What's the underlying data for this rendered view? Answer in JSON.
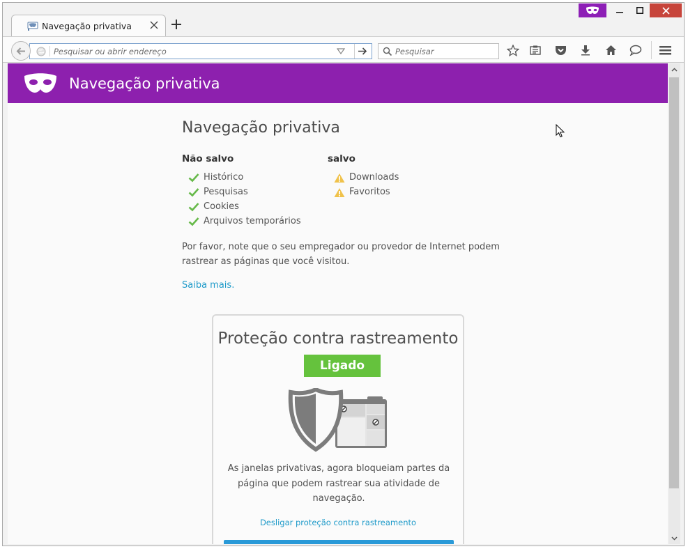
{
  "window": {
    "tab": {
      "title": "Navegação privativa"
    },
    "colors": {
      "private_purple": "#8d20ae",
      "close_red": "#c7453b",
      "link": "#1e9ac9",
      "badge_green": "#65c23d"
    }
  },
  "toolbar": {
    "url_placeholder": "Pesquisar ou abrir endereço",
    "search_placeholder": "Pesquisar",
    "icons": [
      "back-icon",
      "identity-icon",
      "dropmarker-icon",
      "go-icon",
      "search-icon",
      "bookmark-star-icon",
      "reading-list-icon",
      "pocket-icon",
      "download-icon",
      "home-icon",
      "chat-icon",
      "menu-icon"
    ]
  },
  "page": {
    "header_title": "Navegação privativa",
    "main_title": "Navegação privativa",
    "not_saved": {
      "heading": "Não salvo",
      "items": [
        "Histórico",
        "Pesquisas",
        "Cookies",
        "Arquivos temporários"
      ]
    },
    "saved": {
      "heading": "salvo",
      "items": [
        "Downloads",
        "Favoritos"
      ]
    },
    "note": "Por favor, note que o seu empregador ou provedor de Internet podem rastrear as páginas que você visitou.",
    "learn_more": "Saiba mais.",
    "tracking": {
      "title": "Proteção contra rastreamento",
      "status": "Ligado",
      "description": "As janelas privativas, agora bloqueiam partes da página que podem rastrear sua atividade de navegação.",
      "toggle_link": "Desligar proteção contra rastreamento"
    }
  }
}
